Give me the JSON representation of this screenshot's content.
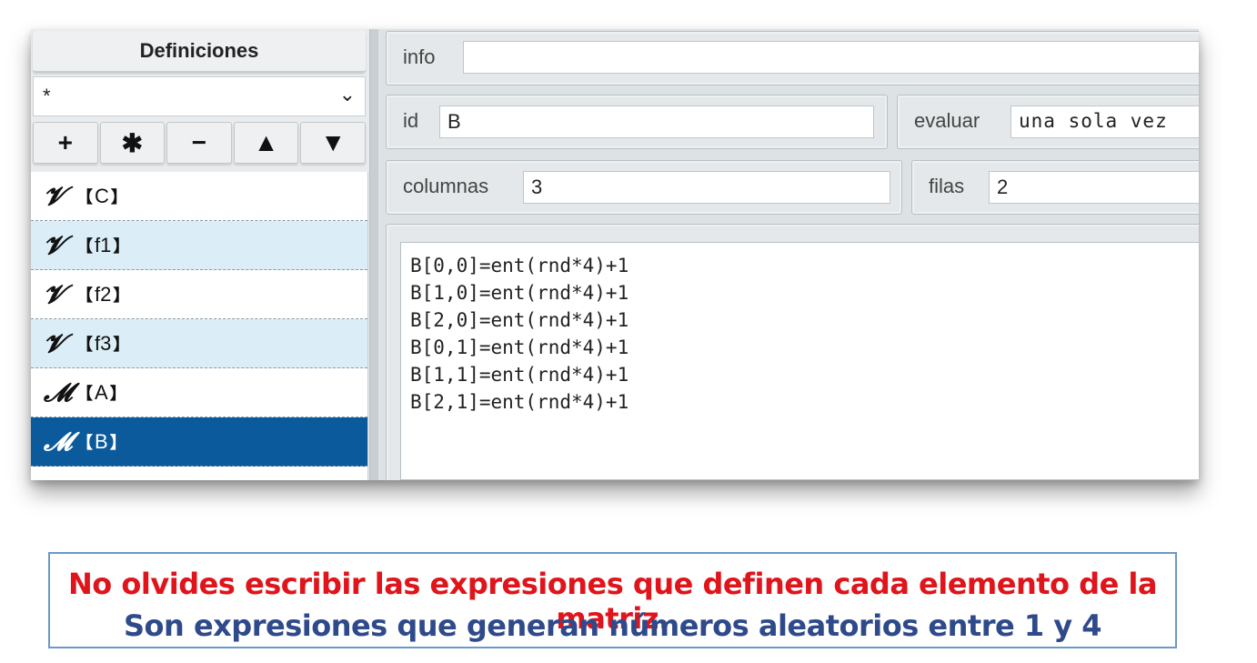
{
  "sidebar": {
    "header": "Definiciones",
    "filter_value": "*",
    "toolbar": [
      "+",
      "✱",
      "−",
      "▲",
      "▼"
    ],
    "items": [
      {
        "glyph": "𝓥",
        "name": "C",
        "state": "normal"
      },
      {
        "glyph": "𝓥",
        "name": "f1",
        "state": "alt"
      },
      {
        "glyph": "𝓥",
        "name": "f2",
        "state": "normal"
      },
      {
        "glyph": "𝓥",
        "name": "f3",
        "state": "alt"
      },
      {
        "glyph": "𝓜",
        "name": "A",
        "state": "normal"
      },
      {
        "glyph": "𝓜",
        "name": "B",
        "state": "selected"
      }
    ]
  },
  "form": {
    "info_label": "info",
    "info_value": "",
    "id_label": "id",
    "id_value": "B",
    "evaluar_label": "evaluar",
    "evaluar_value": "una sola vez",
    "columnas_label": "columnas",
    "columnas_value": "3",
    "filas_label": "filas",
    "filas_value": "2",
    "code_lines": [
      "B[0,0]=ent(rnd*4)+1",
      "B[1,0]=ent(rnd*4)+1",
      "B[2,0]=ent(rnd*4)+1",
      "B[0,1]=ent(rnd*4)+1",
      "B[1,1]=ent(rnd*4)+1",
      "B[2,1]=ent(rnd*4)+1"
    ]
  },
  "note": {
    "line1": "No olvides escribir las expresiones que definen cada elemento de la matriz.",
    "line2": "Son expresiones que generan números aleatorios entre 1 y 4"
  },
  "colors": {
    "selected": "#0b5a9c",
    "alt_row": "#dbeef7",
    "note_red": "#e0141b",
    "note_blue": "#2e4a8a",
    "note_border": "#6a99c7"
  }
}
